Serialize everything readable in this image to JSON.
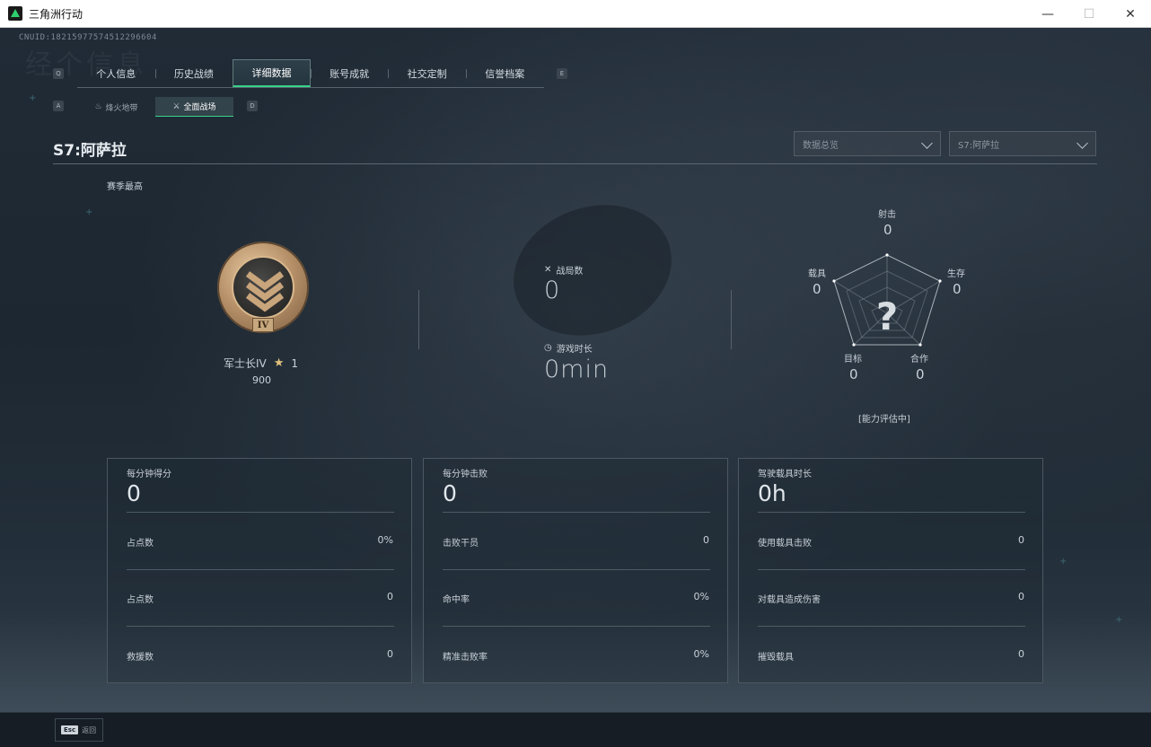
{
  "window": {
    "title": "三角洲行动",
    "minimize": "—",
    "maximize": "☐",
    "close": "✕"
  },
  "uid": "CNUID:18215977574512296604",
  "watermark": "经个信息",
  "tab_keys": {
    "left": "Q",
    "right": "E",
    "sub_left": "A",
    "sub_right": "D"
  },
  "tabs": [
    {
      "label": "个人信息"
    },
    {
      "label": "历史战绩"
    },
    {
      "label": "详细数据",
      "active": true
    },
    {
      "label": "账号成就"
    },
    {
      "label": "社交定制"
    },
    {
      "label": "信誉档案"
    }
  ],
  "subtabs": [
    {
      "label": "烽火地带",
      "icon": "fire-zone-icon"
    },
    {
      "label": "全面战场",
      "icon": "battlefield-icon",
      "active": true
    }
  ],
  "season": {
    "title": "S7:阿萨拉",
    "dropdown_data": "数据总览",
    "dropdown_season": "S7:阿萨拉",
    "best_label": "赛季最高"
  },
  "rank": {
    "tier_numeral": "IV",
    "name": "军士长IV",
    "stars": "1",
    "score": "900"
  },
  "center": {
    "matches_label": "战局数",
    "matches_value": "0",
    "playtime_label": "游戏时长",
    "playtime_value": "0min"
  },
  "radar": {
    "center_mark": "?",
    "axes": [
      {
        "label": "射击",
        "value": "0"
      },
      {
        "label": "生存",
        "value": "0"
      },
      {
        "label": "合作",
        "value": "0"
      },
      {
        "label": "目标",
        "value": "0"
      },
      {
        "label": "载具",
        "value": "0"
      }
    ],
    "status": "[能力评估中]"
  },
  "panels": [
    {
      "title": "每分钟得分",
      "value": "0",
      "rows": [
        {
          "label": "占点数",
          "value": "0%"
        },
        {
          "label": "占点数",
          "value": "0"
        },
        {
          "label": "救援数",
          "value": "0"
        }
      ]
    },
    {
      "title": "每分钟击败",
      "value": "0",
      "rows": [
        {
          "label": "击败干员",
          "value": "0"
        },
        {
          "label": "命中率",
          "value": "0%"
        },
        {
          "label": "精准击败率",
          "value": "0%"
        }
      ]
    },
    {
      "title": "驾驶载具时长",
      "value": "0h",
      "rows": [
        {
          "label": "使用载具击败",
          "value": "0"
        },
        {
          "label": "对载具造成伤害",
          "value": "0"
        },
        {
          "label": "摧毁载具",
          "value": "0"
        }
      ]
    }
  ],
  "footer": {
    "esc_key": "Esc",
    "esc_label": "返回"
  },
  "colors": {
    "accent": "#38d38a",
    "background": "#1b2530",
    "gold": "#e2c27d"
  }
}
